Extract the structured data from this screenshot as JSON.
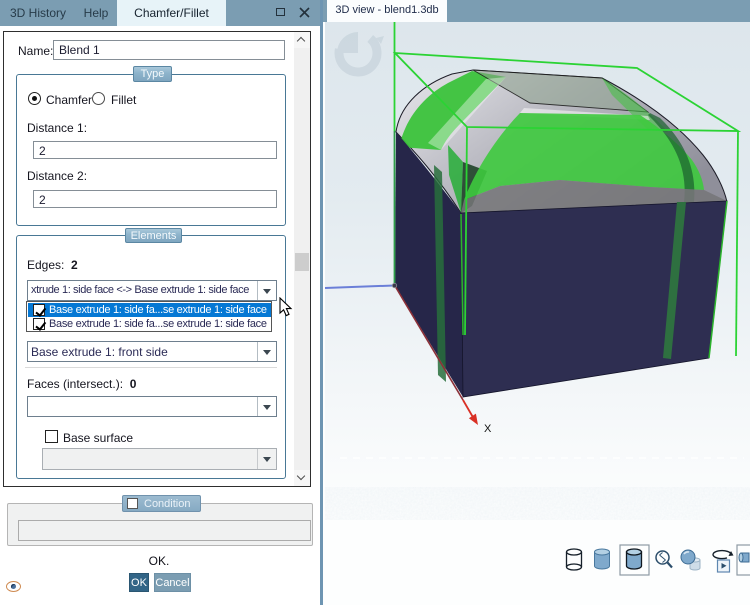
{
  "left_panel": {
    "tabs": {
      "history": "3D History",
      "help": "Help",
      "chamfer": "Chamfer/Fillet"
    },
    "name_label": "Name:",
    "name_value": "Blend 1",
    "type_group": {
      "title": "Type",
      "radio_chamfer": "Chamfer",
      "radio_fillet": "Fillet",
      "selected": "Chamfer",
      "distance1_label": "Distance 1:",
      "distance1_value": "2",
      "distance2_label": "Distance 2:",
      "distance2_value": "2"
    },
    "elements_group": {
      "title": "Elements",
      "edges_label": "Edges:",
      "edges_count": "2",
      "edge_combo_value": "xtrude 1: side face <-> Base extrude 1: side face",
      "dropdown_items": [
        {
          "label": "Base extrude 1: side fa...se extrude 1: side face",
          "checked": true,
          "highlighted": true
        },
        {
          "label": "Base extrude 1: side fa...se extrude 1: side face",
          "checked": true,
          "highlighted": false
        }
      ],
      "face_combo_value": "Base extrude 1: front side",
      "faces_label": "Faces (intersect.):",
      "faces_count": "0",
      "faces_combo_value": "",
      "base_surface_label": "Base surface",
      "base_surface_checked": false,
      "base_surface_combo_value": ""
    },
    "condition_group": {
      "title": "Condition",
      "checked": false,
      "value": ""
    },
    "status_text": "OK.",
    "ok_label": "OK",
    "cancel_label": "Cancel"
  },
  "right_panel": {
    "tab_label": "3D view - blend1.3db",
    "x_axis_label": "X",
    "toolbar_icons": [
      "wireframe-view",
      "shaded-view",
      "shaded-edges-view",
      "zoom-extents",
      "shaded-hidden-view",
      "rotate-animation",
      "extra-view"
    ]
  },
  "colors": {
    "tabbar": "#7b9db2",
    "active_tab": "#e7f3f8",
    "group_border": "#497895",
    "highlight_row": "#0578d4",
    "ok_button": "#326587",
    "cancel_button": "#7b9db2",
    "model_front": "#2e2e51",
    "model_left": "#262649",
    "green_edge": "#2bd334"
  }
}
